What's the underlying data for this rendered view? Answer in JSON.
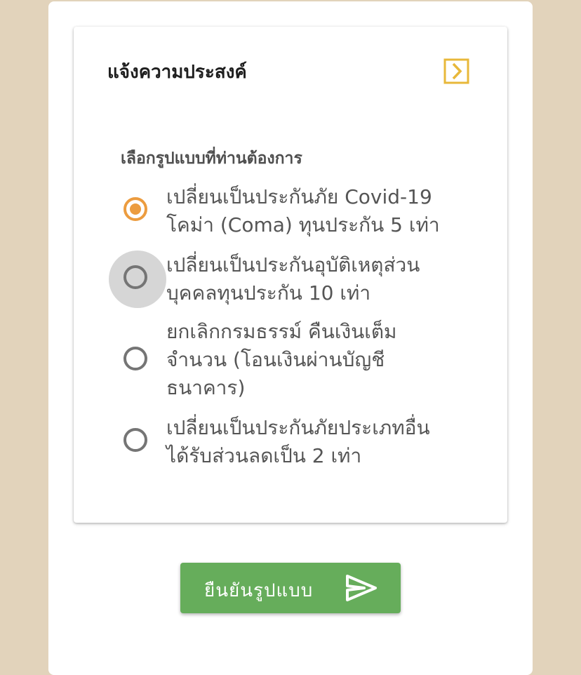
{
  "card": {
    "title": "แจ้งความประสงค์",
    "expand_icon": "chevron-right-box-icon",
    "question": "เลือกรูปแบบที่ท่านต้องการ"
  },
  "options": [
    {
      "lines": [
        "เปลี่ยนเป็นประกันภัย Covid-19",
        "โคม่า (Coma) ทุนประกัน 5 เท่า"
      ],
      "selected": true
    },
    {
      "lines": [
        "เปลี่ยนเป็นประกันอุบัติเหตุส่วน",
        "บุคคลทุนประกัน 10 เท่า"
      ],
      "selected": false
    },
    {
      "lines": [
        "ยกเลิกกรมธรรม์ คืนเงินเต็ม",
        "จำนวน (โอนเงินผ่านบัญชี",
        "ธนาคาร)"
      ],
      "selected": false
    },
    {
      "lines": [
        "เปลี่ยนเป็นประกันภัยประเภทอื่น",
        "ได้รับส่วนลดเป็น 2 เท่า"
      ],
      "selected": false
    }
  ],
  "confirm": {
    "label": "ยืนยันรูปแบบ",
    "icon": "send-icon"
  },
  "colors": {
    "background": "#e2d3bb",
    "accent": "#ec9c3f",
    "icon_yellow": "#e8b83a",
    "button_green": "#66ad5b",
    "focus_halo": "#d6d6d6"
  }
}
